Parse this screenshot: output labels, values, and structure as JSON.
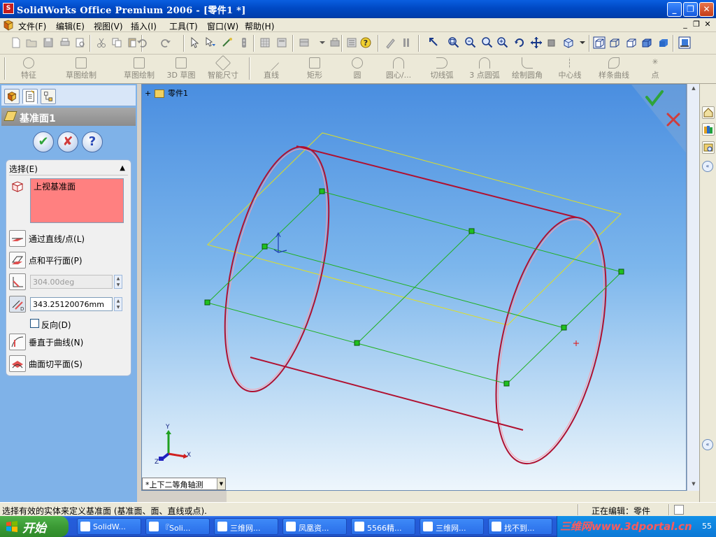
{
  "window": {
    "title": "SolidWorks Office Premium 2006 - [零件1 *]",
    "min": "_",
    "restore": "❐",
    "close": "✕"
  },
  "menu": {
    "items": [
      "文件(F)",
      "编辑(E)",
      "视图(V)",
      "插入(I)",
      "工具(T)",
      "窗口(W)",
      "帮助(H)"
    ],
    "mdi_min": "_",
    "mdi_restore": "❐",
    "mdi_close": "✕"
  },
  "sketch_toolbar": {
    "items": [
      "特征",
      "草图绘制",
      "草图绘制",
      "3D 草图",
      "智能尺寸",
      "直线",
      "矩形",
      "圆",
      "圆心/...",
      "切线弧",
      "3 点圆弧",
      "绘制圆角",
      "中心线",
      "样条曲线",
      "点"
    ]
  },
  "property_manager": {
    "title": "基准面1",
    "ok": "✔",
    "cancel": "✘",
    "help": "?",
    "section": "选择(E)",
    "collapse": "▲",
    "selection": "上视基准面",
    "options": {
      "through_line": "通过直线/点(L)",
      "parallel_plane": "点和平行面(P)",
      "angle_value": "304.00deg",
      "distance_value": "343.25120076mm",
      "reverse": "反向(D)",
      "normal_curve": "垂直于曲线(N)",
      "surface_tangent": "曲面切平面(S)"
    }
  },
  "viewport": {
    "tree_expand": "+",
    "tree_label": "零件1",
    "view_orientation": "*上下二等角轴测",
    "triad": {
      "x": "X",
      "y": "Y",
      "z": "Z"
    },
    "colors": {
      "edge": "#b01030",
      "preview_plane": "#20b020",
      "reference_plane": "#e0e020",
      "confirm_ok": "#2fa43a",
      "confirm_cancel": "#d03c3c"
    }
  },
  "status": {
    "message": "选择有效的实体来定义基准面 (基准面、面、直线或点).",
    "editing": "正在编辑：零件"
  },
  "taskbar": {
    "start": "开始",
    "items": [
      "SolidW...",
      "『Soli...",
      "三维网...",
      "凤凰资...",
      "5566精...",
      "三维网...",
      "找不到..."
    ],
    "watermark": "三维网www.3dportal.cn",
    "time": "55"
  }
}
